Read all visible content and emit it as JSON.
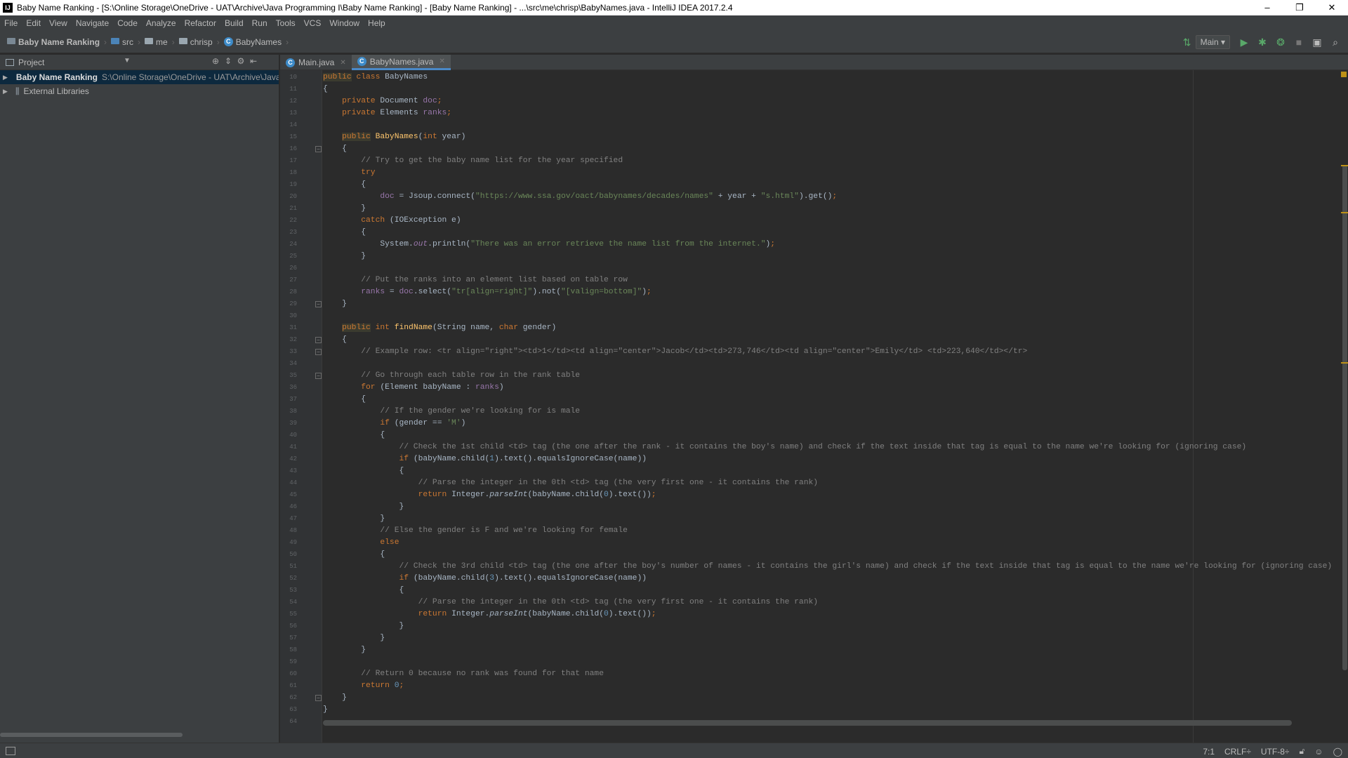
{
  "window": {
    "title": "Baby Name Ranking - [S:\\Online Storage\\OneDrive - UAT\\Archive\\Java Programming I\\Baby Name Ranking] - [Baby Name Ranking] - ...\\src\\me\\chrisp\\BabyNames.java - IntelliJ IDEA 2017.2.4",
    "app_icon": "IJ",
    "minimize": "–",
    "restore": "❐",
    "close": "✕"
  },
  "menu": [
    "File",
    "Edit",
    "View",
    "Navigate",
    "Code",
    "Analyze",
    "Refactor",
    "Build",
    "Run",
    "Tools",
    "VCS",
    "Window",
    "Help"
  ],
  "breadcrumbs": [
    "Baby Name Ranking",
    "src",
    "me",
    "chrisp",
    "BabyNames"
  ],
  "toolbar": {
    "run_config": "Main ▾",
    "icons": [
      "build-icon",
      "run-icon",
      "debug-icon",
      "coverage-icon",
      "stop-icon",
      "project-structure-icon",
      "search-icon"
    ]
  },
  "project_panel": {
    "title": "Project",
    "dropdown": "▼",
    "tree": [
      {
        "name": "Baby Name Ranking",
        "path": "S:\\Online Storage\\OneDrive - UAT\\Archive\\Java Programming I\\Baby Name Ranking"
      },
      {
        "name": "External Libraries",
        "path": ""
      }
    ]
  },
  "tabs": [
    {
      "label": "Main.java",
      "active": false
    },
    {
      "label": "BabyNames.java",
      "active": true
    }
  ],
  "editor": {
    "lines": [
      {
        "n": "10",
        "html": "<span class=\"kw hl\">public</span> <span class=\"kw\">class</span> <span class=\"plain\">BabyNames</span>"
      },
      {
        "n": "11",
        "html": "<span class=\"plain\">{</span>"
      },
      {
        "n": "12",
        "html": "    <span class=\"kw\">private</span> <span class=\"plain\">Document</span> <span class=\"fld\">doc</span><span class=\"kw\">;</span>"
      },
      {
        "n": "13",
        "html": "    <span class=\"kw\">private</span> <span class=\"plain\">Elements</span> <span class=\"fld\">ranks</span><span class=\"kw\">;</span>"
      },
      {
        "n": "14",
        "html": ""
      },
      {
        "n": "15",
        "html": "    <span class=\"kw hl\">public</span> <span class=\"fn\">BabyNames</span><span class=\"plain\">(</span><span class=\"kw\">int</span> <span class=\"plain\">year)</span>"
      },
      {
        "n": "16",
        "html": "    <span class=\"plain\">{</span>"
      },
      {
        "n": "17",
        "html": "        <span class=\"cmt\">// Try to get the baby name list for the year specified</span>"
      },
      {
        "n": "18",
        "html": "        <span class=\"kw\">try</span>"
      },
      {
        "n": "19",
        "html": "        <span class=\"plain\">{</span>"
      },
      {
        "n": "20",
        "html": "            <span class=\"fld\">doc</span> <span class=\"plain\">= Jsoup.</span><span class=\"plain\">connect(</span><span class=\"str\">\"https://www.ssa.gov/oact/babynames/decades/names\"</span> <span class=\"plain\">+ year +</span> <span class=\"str\">\"s.html\"</span><span class=\"plain\">).get()</span><span class=\"kw\">;</span>"
      },
      {
        "n": "21",
        "html": "        <span class=\"plain\">}</span>"
      },
      {
        "n": "22",
        "html": "        <span class=\"kw\">catch</span> <span class=\"plain\">(IOException e)</span>"
      },
      {
        "n": "23",
        "html": "        <span class=\"plain\">{</span>"
      },
      {
        "n": "24",
        "html": "            <span class=\"plain\">System.</span><span class=\"fld it\">out</span><span class=\"plain\">.println(</span><span class=\"str\">\"There was an error retrieve the name list from the internet.\"</span><span class=\"plain\">)</span><span class=\"kw\">;</span>"
      },
      {
        "n": "25",
        "html": "        <span class=\"plain\">}</span>"
      },
      {
        "n": "26",
        "html": ""
      },
      {
        "n": "27",
        "html": "        <span class=\"cmt\">// Put the ranks into an element list based on table row</span>"
      },
      {
        "n": "28",
        "html": "        <span class=\"fld\">ranks</span> <span class=\"plain\">=</span> <span class=\"fld\">doc</span><span class=\"plain\">.select(</span><span class=\"str\">\"tr[align=right]\"</span><span class=\"plain\">).not(</span><span class=\"str\">\"[valign=bottom]\"</span><span class=\"plain\">)</span><span class=\"kw\">;</span>"
      },
      {
        "n": "29",
        "html": "    <span class=\"plain\">}</span>"
      },
      {
        "n": "30",
        "html": ""
      },
      {
        "n": "31",
        "html": "    <span class=\"kw hl\">public</span> <span class=\"kw\">int</span> <span class=\"fn\">findName</span><span class=\"plain\">(String name,</span> <span class=\"kw\">char</span> <span class=\"plain\">gender)</span>"
      },
      {
        "n": "32",
        "html": "    <span class=\"plain\">{</span>"
      },
      {
        "n": "33",
        "html": "        <span class=\"cmt\">// Example row: &lt;tr align=\"right\"&gt;&lt;td&gt;1&lt;/td&gt;&lt;td align=\"center\"&gt;Jacob&lt;/td&gt;&lt;td&gt;273,746&lt;/td&gt;&lt;td align=\"center\"&gt;Emily&lt;/td&gt; &lt;td&gt;223,640&lt;/td&gt;&lt;/tr&gt;</span>"
      },
      {
        "n": "34",
        "html": ""
      },
      {
        "n": "35",
        "html": "        <span class=\"cmt\">// Go through each table row in the rank table</span>"
      },
      {
        "n": "36",
        "html": "        <span class=\"kw\">for</span> <span class=\"plain\">(Element babyName :</span> <span class=\"fld\">ranks</span><span class=\"plain\">)</span>"
      },
      {
        "n": "37",
        "html": "        <span class=\"plain\">{</span>"
      },
      {
        "n": "38",
        "html": "            <span class=\"cmt\">// If the gender we're looking for is male</span>"
      },
      {
        "n": "39",
        "html": "            <span class=\"kw\">if</span> <span class=\"plain\">(gender ==</span> <span class=\"str\">'M'</span><span class=\"plain\">)</span>"
      },
      {
        "n": "40",
        "html": "            <span class=\"plain\">{</span>"
      },
      {
        "n": "41",
        "html": "                <span class=\"cmt\">// Check the 1st child &lt;td&gt; tag (the one after the rank - it contains the boy's name) and check if the text inside that tag is equal to the name we're looking for (ignoring case)</span>"
      },
      {
        "n": "42",
        "html": "                <span class=\"kw\">if</span> <span class=\"plain\">(babyName.child(</span><span class=\"num\">1</span><span class=\"plain\">).text().equalsIgnoreCase(name))</span>"
      },
      {
        "n": "43",
        "html": "                <span class=\"plain\">{</span>"
      },
      {
        "n": "44",
        "html": "                    <span class=\"cmt\">// Parse the integer in the 0th &lt;td&gt; tag (the very first one - it contains the rank)</span>"
      },
      {
        "n": "45",
        "html": "                    <span class=\"kw\">return</span> <span class=\"plain\">Integer.</span><span class=\"plain it\">parseInt</span><span class=\"plain\">(babyName.child(</span><span class=\"num\">0</span><span class=\"plain\">).text())</span><span class=\"kw\">;</span>"
      },
      {
        "n": "46",
        "html": "                <span class=\"plain\">}</span>"
      },
      {
        "n": "47",
        "html": "            <span class=\"plain\">}</span>"
      },
      {
        "n": "48",
        "html": "            <span class=\"cmt\">// Else the gender is F and we're looking for female</span>"
      },
      {
        "n": "49",
        "html": "            <span class=\"kw\">else</span>"
      },
      {
        "n": "50",
        "html": "            <span class=\"plain\">{</span>"
      },
      {
        "n": "51",
        "html": "                <span class=\"cmt\">// Check the 3rd child &lt;td&gt; tag (the one after the boy's number of names - it contains the girl's name) and check if the text inside that tag is equal to the name we're looking for (ignoring case)</span>"
      },
      {
        "n": "52",
        "html": "                <span class=\"kw\">if</span> <span class=\"plain\">(babyName.child(</span><span class=\"num\">3</span><span class=\"plain\">).text().equalsIgnoreCase(name))</span>"
      },
      {
        "n": "53",
        "html": "                <span class=\"plain\">{</span>"
      },
      {
        "n": "54",
        "html": "                    <span class=\"cmt\">// Parse the integer in the 0th &lt;td&gt; tag (the very first one - it contains the rank)</span>"
      },
      {
        "n": "55",
        "html": "                    <span class=\"kw\">return</span> <span class=\"plain\">Integer.</span><span class=\"plain it\">parseInt</span><span class=\"plain\">(babyName.child(</span><span class=\"num\">0</span><span class=\"plain\">).text())</span><span class=\"kw\">;</span>"
      },
      {
        "n": "56",
        "html": "                <span class=\"plain\">}</span>"
      },
      {
        "n": "57",
        "html": "            <span class=\"plain\">}</span>"
      },
      {
        "n": "58",
        "html": "        <span class=\"plain\">}</span>"
      },
      {
        "n": "59",
        "html": ""
      },
      {
        "n": "60",
        "html": "        <span class=\"cmt\">// Return 0 because no rank was found for that name</span>"
      },
      {
        "n": "61",
        "html": "        <span class=\"kw\">return</span> <span class=\"num\">0</span><span class=\"kw\">;</span>"
      },
      {
        "n": "62",
        "html": "    <span class=\"plain\">}</span>"
      },
      {
        "n": "63",
        "html": "<span class=\"plain\">}</span>"
      },
      {
        "n": "64",
        "html": ""
      }
    ]
  },
  "status_bar": {
    "position": "7:1",
    "line_separator": "CRLF÷",
    "encoding": "UTF-8÷"
  },
  "colors": {
    "keyword": "#cc7832",
    "string": "#6a8759",
    "comment": "#808080",
    "field": "#9876aa",
    "number": "#6897bb",
    "method": "#ffc66d",
    "background": "#2b2b2b"
  }
}
